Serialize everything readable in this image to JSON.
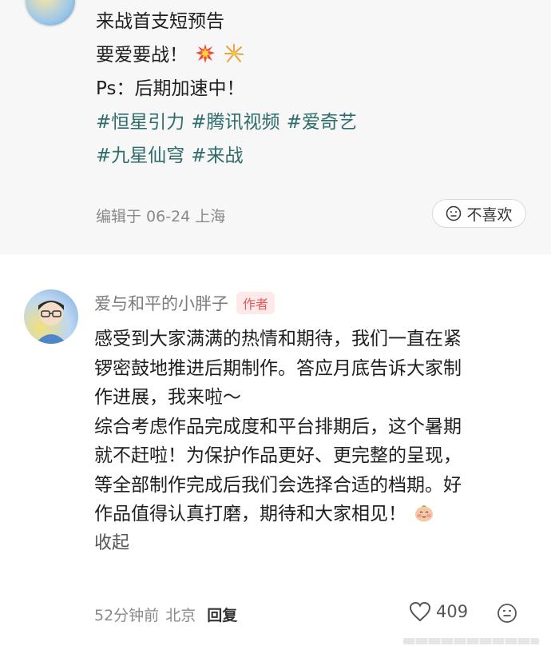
{
  "post": {
    "lines": [
      "来战首支短预告",
      "要爱要战！",
      "Ps：后期加速中！"
    ],
    "tags_row1": [
      "#恒星引力",
      "#腾讯视频",
      "#爱奇艺"
    ],
    "tags_row2": [
      "#九星仙穹",
      "#来战"
    ],
    "meta": "编辑于 06-24 上海",
    "dislike_label": "不喜欢"
  },
  "comment": {
    "name": "爱与和平的小胖子",
    "badge": "作者",
    "lines": [
      "感受到大家满满的热情和期待，我们一直在紧",
      "锣密鼓地推进后期制作。答应月底告诉大家制",
      "作进展，我来啦～",
      "综合考虑作品完成度和平台排期后，这个暑期",
      "就不赶啦！为保护作品更好、更完整的呈现，",
      "等全部制作完成后我们会选择合适的档期。好",
      "作品值得认真打磨，期待和大家相见！"
    ],
    "collapse_label": "收起",
    "time": "52分钟前",
    "location": "北京",
    "reply_label": "回复",
    "likes": "409"
  },
  "icons": {
    "dislike": "frown-face-icon",
    "like": "heart-icon",
    "menu": "face-menu-icon",
    "emoji1": "collision-emoji-icon",
    "emoji2": "firework-emoji-icon",
    "emoji3": "blushing-face-emoji-icon"
  },
  "colors": {
    "tag": "#2d6c6a",
    "badge_text": "#e45a5a",
    "badge_bg": "#fde9e9",
    "post_bg": "#f7f7f7"
  }
}
